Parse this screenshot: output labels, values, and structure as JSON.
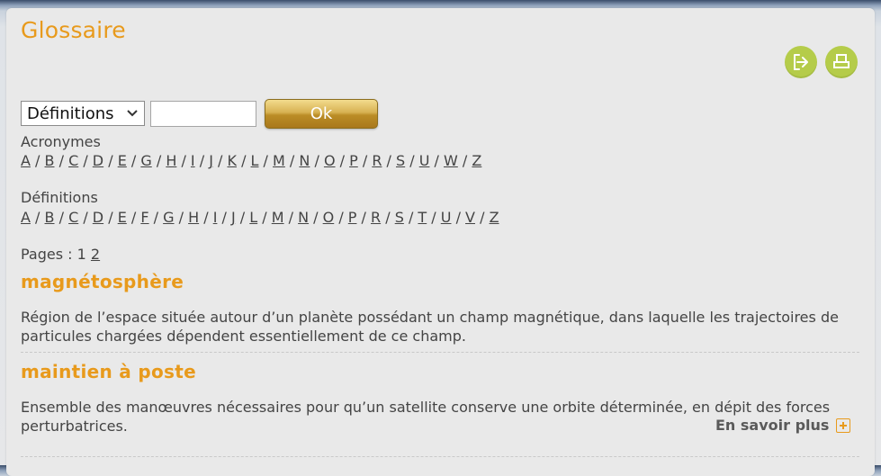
{
  "title": "Glossaire",
  "icons": {
    "share": "share-arrow-icon",
    "print": "printer-icon",
    "accent_color": "#b5cc4a"
  },
  "search": {
    "select_value": "Définitions",
    "input_value": "",
    "ok_label": "Ok"
  },
  "acronymes": {
    "label": "Acronymes",
    "letters": [
      "A",
      "B",
      "C",
      "D",
      "E",
      "G",
      "H",
      "I",
      "J",
      "K",
      "L",
      "M",
      "N",
      "O",
      "P",
      "R",
      "S",
      "U",
      "W",
      "Z"
    ]
  },
  "definitions_index": {
    "label": "Définitions",
    "letters": [
      "A",
      "B",
      "C",
      "D",
      "E",
      "F",
      "G",
      "H",
      "I",
      "J",
      "L",
      "M",
      "N",
      "O",
      "P",
      "R",
      "S",
      "T",
      "U",
      "V",
      "Z"
    ]
  },
  "pages": {
    "label": "Pages :",
    "current": "1",
    "other": "2"
  },
  "entries": [
    {
      "term": "magnétosphère",
      "definition": "Région de l’espace située autour d’un planète possédant un champ magnétique, dans laquelle les trajectoires de particules chargées dépendent essentiellement de ce champ."
    },
    {
      "term": "maintien à poste",
      "definition": "Ensemble des manœuvres nécessaires pour qu’un satellite conserve une orbite déterminée, en dépit des forces perturbatrices.",
      "more_label": "En savoir plus"
    }
  ],
  "colors": {
    "title": "#e89a1c",
    "ok_button": "#c79a35"
  }
}
